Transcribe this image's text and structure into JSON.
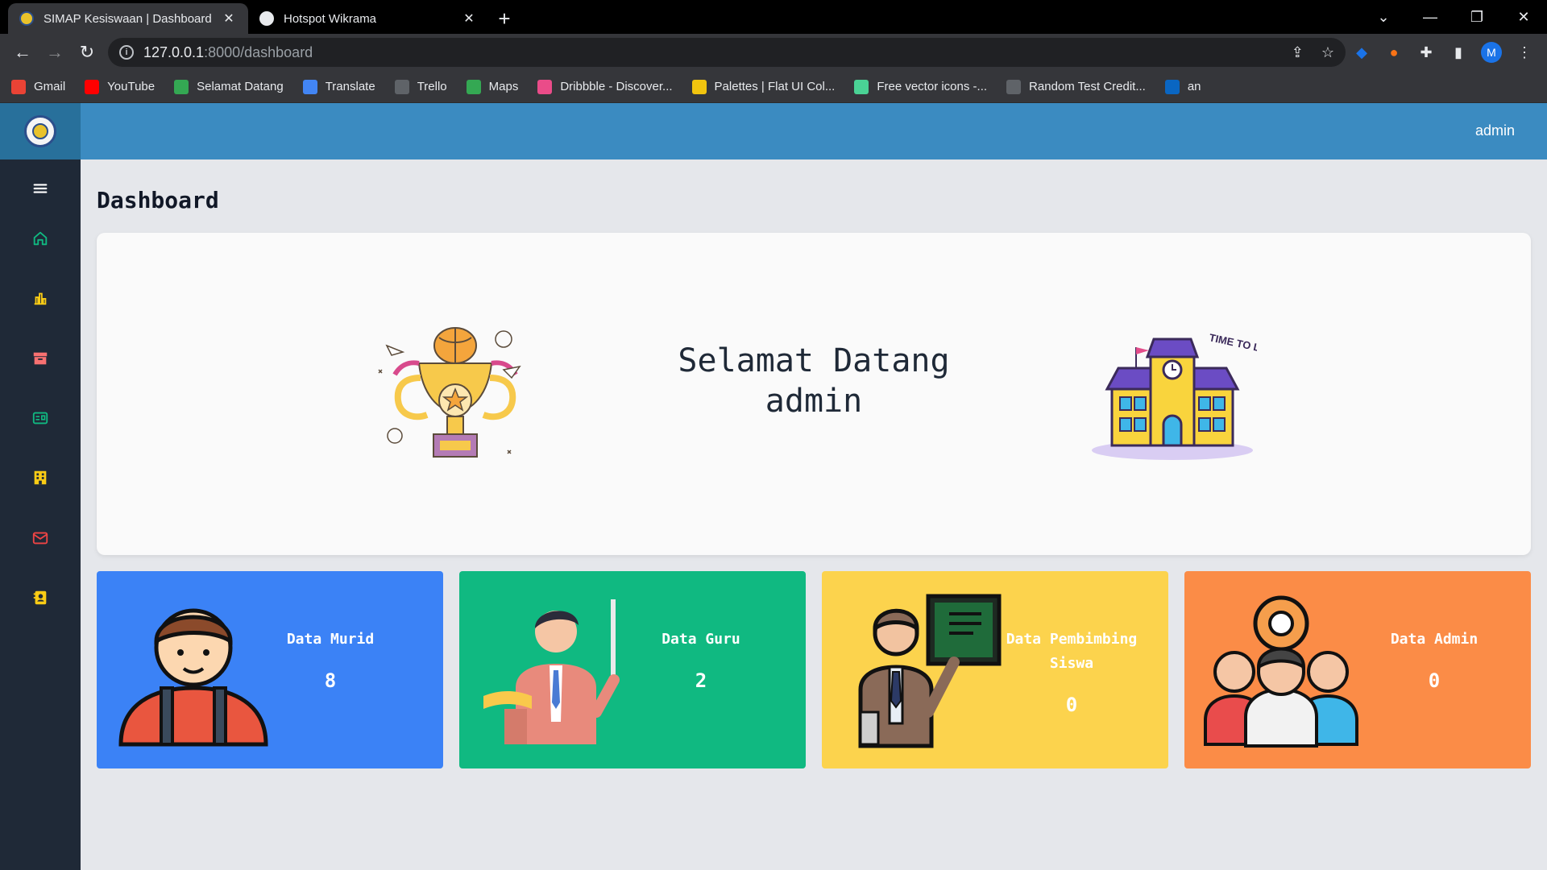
{
  "browser": {
    "tabs": [
      {
        "title": "SIMAP Kesiswaan | Dashboard",
        "close": "✕"
      },
      {
        "title": "Hotspot Wikrama",
        "close": "✕"
      }
    ],
    "new_tab": "+",
    "url_host": "127.0.0.1",
    "url_path": ":8000/dashboard",
    "profile_initial": "M",
    "bookmarks": [
      {
        "label": "Gmail",
        "icon": "gmail-icon",
        "color": "#ea4335"
      },
      {
        "label": "YouTube",
        "icon": "youtube-icon",
        "color": "#ff0000"
      },
      {
        "label": "Selamat Datang",
        "icon": "selamat-datang-icon",
        "color": "#34a853"
      },
      {
        "label": "Translate",
        "icon": "translate-icon",
        "color": "#4285f4"
      },
      {
        "label": "Trello",
        "icon": "trello-icon",
        "color": "#5f6368"
      },
      {
        "label": "Maps",
        "icon": "maps-icon",
        "color": "#34a853"
      },
      {
        "label": "Dribbble - Discover...",
        "icon": "dribbble-icon",
        "color": "#ea4c89"
      },
      {
        "label": "Palettes | Flat UI Col...",
        "icon": "palettes-icon",
        "color": "#f1c40f"
      },
      {
        "label": "Free vector icons -...",
        "icon": "flaticon-icon",
        "color": "#4ad295"
      },
      {
        "label": "Random Test Credit...",
        "icon": "gear-icon",
        "color": "#5f6368"
      },
      {
        "label": "an",
        "icon": "linkedin-icon",
        "color": "#0a66c2"
      }
    ]
  },
  "app": {
    "user": "admin",
    "page_title": "Dashboard",
    "welcome_line1": "Selamat Datang",
    "welcome_line2": "admin",
    "time_to_learn": "TIME TO LEARN!",
    "sidebar": [
      {
        "name": "menu-icon",
        "color": "#ffffff"
      },
      {
        "name": "home-icon",
        "color": "#10b981"
      },
      {
        "name": "chart-icon",
        "color": "#facc15"
      },
      {
        "name": "archive-icon",
        "color": "#f87171"
      },
      {
        "name": "id-card-icon",
        "color": "#10b981"
      },
      {
        "name": "building-icon",
        "color": "#facc15"
      },
      {
        "name": "mail-icon",
        "color": "#ef4444"
      },
      {
        "name": "contact-icon",
        "color": "#facc15"
      }
    ],
    "cards": [
      {
        "label": "Data Murid",
        "value": "8",
        "color": "#3b82f6"
      },
      {
        "label": "Data Guru",
        "value": "2",
        "color": "#10b981"
      },
      {
        "label_line1": "Data Pembimbing",
        "label_line2": "Siswa",
        "value": "0",
        "color": "#fcd34d"
      },
      {
        "label": "Data Admin",
        "value": "0",
        "color": "#fb8c47"
      }
    ]
  }
}
